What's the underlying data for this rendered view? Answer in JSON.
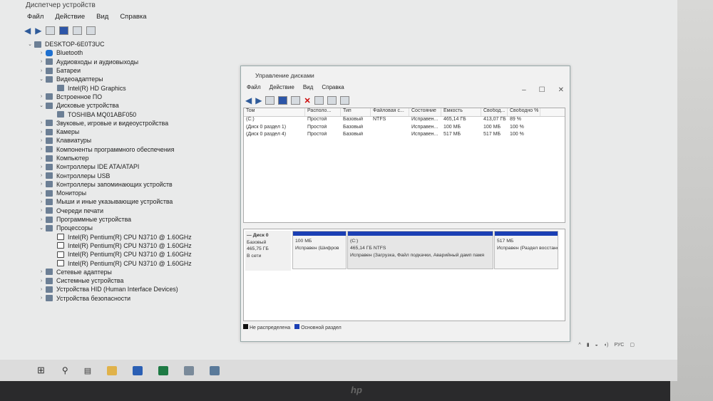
{
  "device_manager": {
    "title": "Диспетчер устройств",
    "menu": [
      "Файл",
      "Действие",
      "Вид",
      "Справка"
    ],
    "tree": [
      {
        "label": "DESKTOP-6E0T3UC",
        "level": 0,
        "state": "open"
      },
      {
        "label": "Bluetooth",
        "level": 1,
        "state": "closed"
      },
      {
        "label": "Аудиовходы и аудиовыходы",
        "level": 1,
        "state": "closed"
      },
      {
        "label": "Батареи",
        "level": 1,
        "state": "closed"
      },
      {
        "label": "Видеоадаптеры",
        "level": 1,
        "state": "open"
      },
      {
        "label": "Intel(R) HD Graphics",
        "level": 2,
        "state": "leaf"
      },
      {
        "label": "Встроенное ПО",
        "level": 1,
        "state": "closed"
      },
      {
        "label": "Дисковые устройства",
        "level": 1,
        "state": "open"
      },
      {
        "label": "TOSHIBA MQ01ABF050",
        "level": 2,
        "state": "leaf"
      },
      {
        "label": "Звуковые, игровые и видеоустройства",
        "level": 1,
        "state": "closed"
      },
      {
        "label": "Камеры",
        "level": 1,
        "state": "closed"
      },
      {
        "label": "Клавиатуры",
        "level": 1,
        "state": "closed"
      },
      {
        "label": "Компоненты программного обеспечения",
        "level": 1,
        "state": "closed"
      },
      {
        "label": "Компьютер",
        "level": 1,
        "state": "closed"
      },
      {
        "label": "Контроллеры IDE ATA/ATAPI",
        "level": 1,
        "state": "closed"
      },
      {
        "label": "Контроллеры USB",
        "level": 1,
        "state": "closed"
      },
      {
        "label": "Контроллеры запоминающих устройств",
        "level": 1,
        "state": "closed"
      },
      {
        "label": "Мониторы",
        "level": 1,
        "state": "closed"
      },
      {
        "label": "Мыши и иные указывающие устройства",
        "level": 1,
        "state": "closed"
      },
      {
        "label": "Очереди печати",
        "level": 1,
        "state": "closed"
      },
      {
        "label": "Программные устройства",
        "level": 1,
        "state": "closed"
      },
      {
        "label": "Процессоры",
        "level": 1,
        "state": "open"
      },
      {
        "label": "Intel(R) Pentium(R) CPU  N3710 @ 1.60GHz",
        "level": 2,
        "state": "cpu"
      },
      {
        "label": "Intel(R) Pentium(R) CPU  N3710 @ 1.60GHz",
        "level": 2,
        "state": "cpu"
      },
      {
        "label": "Intel(R) Pentium(R) CPU  N3710 @ 1.60GHz",
        "level": 2,
        "state": "cpu"
      },
      {
        "label": "Intel(R) Pentium(R) CPU  N3710 @ 1.60GHz",
        "level": 2,
        "state": "cpu"
      },
      {
        "label": "Сетевые адаптеры",
        "level": 1,
        "state": "closed"
      },
      {
        "label": "Системные устройства",
        "level": 1,
        "state": "closed"
      },
      {
        "label": "Устройства HID (Human Interface Devices)",
        "level": 1,
        "state": "closed"
      },
      {
        "label": "Устройства безопасности",
        "level": 1,
        "state": "closed"
      }
    ]
  },
  "disk_management": {
    "title": "Управление дисками",
    "menu": [
      "Файл",
      "Действие",
      "Вид",
      "Справка"
    ],
    "columns": [
      "Том",
      "Располо...",
      "Тип",
      "Файловая с...",
      "Состояние",
      "Емкость",
      "Свобод...",
      "Свободно %"
    ],
    "rows": [
      [
        "(C:)",
        "Простой",
        "Базовый",
        "NTFS",
        "Исправен...",
        "465,14 ГБ",
        "413,07 ГБ",
        "89 %"
      ],
      [
        "(Диск 0 раздел 1)",
        "Простой",
        "Базовый",
        "",
        "Исправен...",
        "100 МБ",
        "100 МБ",
        "100 %"
      ],
      [
        "(Диск 0 раздел 4)",
        "Простой",
        "Базовый",
        "",
        "Исправен...",
        "517 МБ",
        "517 МБ",
        "100 %"
      ]
    ],
    "disk": {
      "name": "Диск 0",
      "type": "Базовый",
      "size": "465,75 ГБ",
      "status": "В сети"
    },
    "partitions": [
      {
        "name": "",
        "size": "100 МБ",
        "status": "Исправен (Шифров"
      },
      {
        "name": "(C:)",
        "size": "465,14 ГБ NTFS",
        "status": "Исправен (Загрузка, Файл подкачки, Аварийный дамп памя"
      },
      {
        "name": "",
        "size": "517 МБ",
        "status": "Исправен (Раздел восстано"
      }
    ],
    "legend": [
      {
        "label": "Не распределена",
        "color": "#111111"
      },
      {
        "label": "Основной раздел",
        "color": "#1b3fb4"
      }
    ]
  },
  "tray": {
    "lang": "РУС"
  },
  "brand": "hp"
}
